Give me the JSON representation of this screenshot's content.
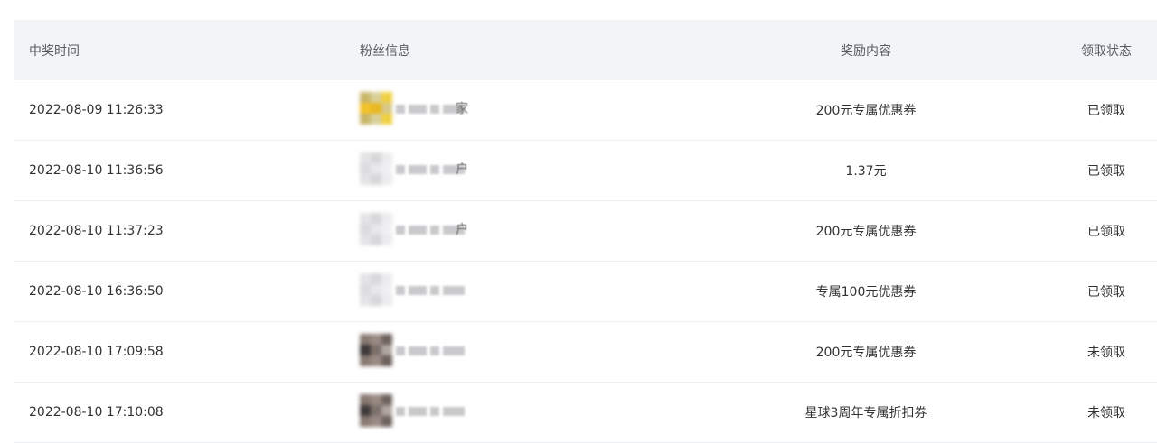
{
  "headers": {
    "time": "中奖时间",
    "fan": "粉丝信息",
    "reward": "奖励内容",
    "status": "领取状态"
  },
  "rows": [
    {
      "time": "2022-08-09 11:26:33",
      "fan_tail": "家",
      "reward": "200元专属优惠券",
      "status": "已领取",
      "avatar": "yellow"
    },
    {
      "time": "2022-08-10 11:36:56",
      "fan_tail": "户",
      "reward": "1.37元",
      "status": "已领取",
      "avatar": "light"
    },
    {
      "time": "2022-08-10 11:37:23",
      "fan_tail": "户",
      "reward": "200元专属优惠券",
      "status": "已领取",
      "avatar": "light"
    },
    {
      "time": "2022-08-10 16:36:50",
      "fan_tail": "",
      "reward": "专属100元优惠券",
      "status": "已领取",
      "avatar": "light"
    },
    {
      "time": "2022-08-10 17:09:58",
      "fan_tail": "",
      "reward": "200元专属优惠券",
      "status": "未领取",
      "avatar": "dark"
    },
    {
      "time": "2022-08-10 17:10:08",
      "fan_tail": "",
      "reward": "星球3周年专属折扣券",
      "status": "未领取",
      "avatar": "dark"
    }
  ]
}
